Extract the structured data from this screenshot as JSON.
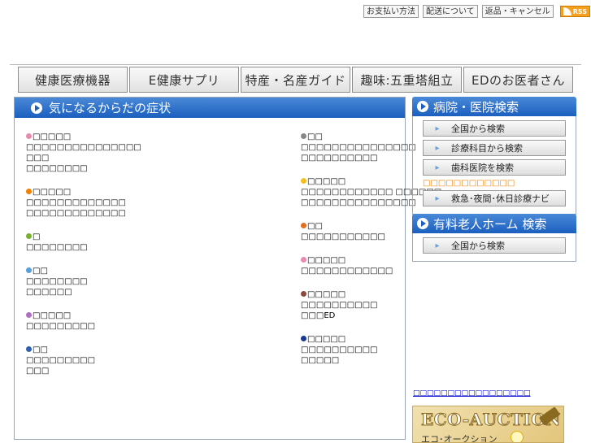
{
  "top_links": [
    "お支払い方法",
    "配送について",
    "返品・キャンセル"
  ],
  "rss_label": "RSS",
  "nav_tabs": [
    "健康医療機器",
    "E健康サプリ",
    "特産・名産ガイド",
    "趣味:五重塔組立",
    "EDのお医者さん"
  ],
  "symptom_panel": {
    "title": "気になるからだの症状",
    "left": [
      {
        "color": "#e88ab0",
        "lines": [
          "□□□□□",
          "□□□□□□□□□□□□□□□",
          "□□□",
          "□□□□□□□□"
        ]
      },
      {
        "color": "#f08000",
        "lines": [
          "□□□□□",
          "□□□□□□□□□□□□□",
          "□□□□□□□□□□□□□"
        ]
      },
      {
        "color": "#7ab030",
        "lines": [
          "□",
          "□□□□□□□□"
        ]
      },
      {
        "color": "#5aa0d8",
        "lines": [
          "□□",
          "□□□□□□□□",
          "□□□□□□"
        ]
      },
      {
        "color": "#b070c0",
        "lines": [
          "□□□□□",
          "□□□□□□□□□"
        ]
      },
      {
        "color": "#3060b0",
        "lines": [
          "□□",
          "□□□□□□□□□",
          "□□□"
        ]
      }
    ],
    "right": [
      {
        "color": "#888888",
        "lines": [
          "□□",
          "□□□□□□□□□□□□□□□",
          "□□□□□□□□□□"
        ]
      },
      {
        "color": "#f0c020",
        "lines": [
          "□□□□□",
          "□□□□□□□□□□□□ □□□□□□",
          "□□□□□□□□□□□□□□□"
        ]
      },
      {
        "color": "#e07020",
        "lines": [
          "□□",
          "□□□□□□□□□□□"
        ]
      },
      {
        "color": "#e88ab0",
        "lines": [
          "□□□□□",
          "□□□□□□□□□□□□"
        ]
      },
      {
        "color": "#8a4a3a",
        "lines": [
          "□□□□□",
          "□□□□□□□□□□",
          "□□□ED"
        ]
      },
      {
        "color": "#1a3a90",
        "lines": [
          "□□□□□",
          "□□□□□□□□□□",
          "□□□□□"
        ]
      }
    ]
  },
  "hospital_panel": {
    "title": "病院・医院検索",
    "buttons": [
      "全国から検索",
      "診療科目から検索",
      "歯科医院を検索"
    ],
    "note": "□□□□□□□□□□□□",
    "emergency_button": "救急･夜間･休日診療ナビ"
  },
  "nursing_panel": {
    "title": "有料老人ホーム 検索",
    "button": "全国から検索"
  },
  "bottom_link": "□□□□□□□□□□□□□□□□□",
  "eco_banner": {
    "title": "ECO-AUCTION",
    "subtitle": "エコ･オークション"
  }
}
